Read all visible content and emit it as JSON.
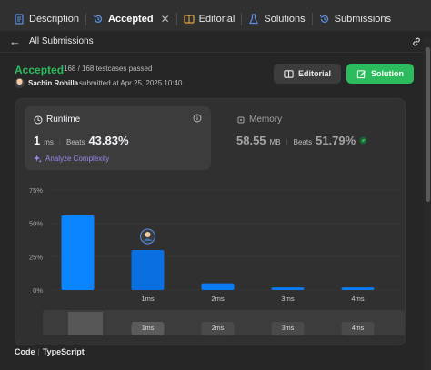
{
  "tabs": [
    {
      "label": "Description",
      "icon": "description-icon",
      "active": false
    },
    {
      "label": "Accepted",
      "icon": "history-icon",
      "active": true
    },
    {
      "label": "Editorial",
      "icon": "book-icon",
      "active": false
    },
    {
      "label": "Solutions",
      "icon": "flask-icon",
      "active": false
    },
    {
      "label": "Submissions",
      "icon": "history-icon",
      "active": false
    }
  ],
  "tab_close": "✕",
  "subheader": {
    "back": "←",
    "title": "All Submissions"
  },
  "submission": {
    "status": "Accepted",
    "testcases": "168 / 168 testcases passed",
    "author": "Sachin Rohilla",
    "submitted": "submitted at Apr 25, 2025 10:40"
  },
  "buttons": {
    "editorial": "Editorial",
    "solution": "Solution"
  },
  "runtime": {
    "title": "Runtime",
    "value": "1",
    "unit": "ms",
    "beats_label": "Beats",
    "beats_pct": "43.83%",
    "analyze": "Analyze Complexity"
  },
  "memory": {
    "title": "Memory",
    "value": "58.55",
    "unit": "MB",
    "beats_label": "Beats",
    "beats_pct": "51.79%"
  },
  "code": {
    "label": "Code",
    "language": "TypeScript"
  },
  "colors": {
    "accent_green": "#2cbb5d",
    "bar_blue": "#007aff",
    "purple": "#9d8aed"
  },
  "chart_data": {
    "type": "bar",
    "categories": [
      "",
      "1ms",
      "2ms",
      "3ms",
      "4ms"
    ],
    "values": [
      56,
      30,
      5,
      2,
      2
    ],
    "y_ticks": [
      "0%",
      "25%",
      "50%",
      "75%"
    ],
    "ylim": [
      0,
      75
    ],
    "highlighted_category": "1ms",
    "mini_labels": [
      "1ms",
      "2ms",
      "3ms",
      "4ms"
    ]
  }
}
